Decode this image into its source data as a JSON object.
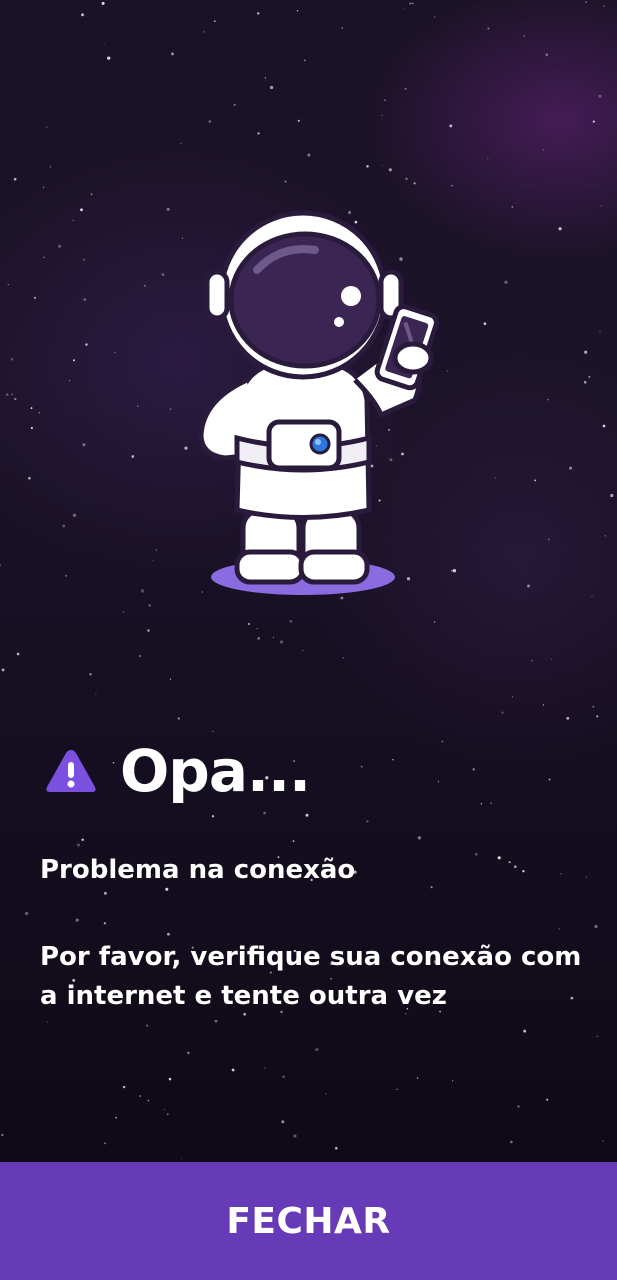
{
  "error_dialog": {
    "title": "Opa...",
    "subtitle": "Problema na conexão",
    "message": "Por favor, verifique sua conexão com a internet e tente outra vez",
    "warning_icon": "warning-triangle-icon",
    "illustration": "astronaut-with-phone"
  },
  "footer": {
    "close_label": "FECHAR"
  },
  "colors": {
    "accent": "#673ab7",
    "warning_icon": "#7b4fe0",
    "background_dark": "#150e20",
    "text": "#ffffff"
  }
}
